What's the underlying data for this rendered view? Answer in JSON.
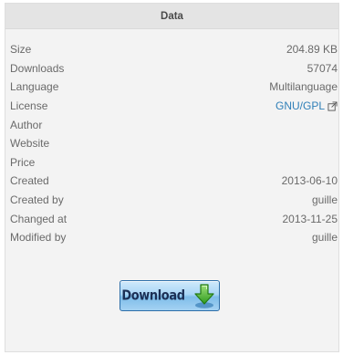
{
  "panel": {
    "title": "Data"
  },
  "rows": [
    {
      "label": "Size",
      "value": "204.89 KB"
    },
    {
      "label": "Downloads",
      "value": "57074"
    },
    {
      "label": "Language",
      "value": "Multilanguage"
    },
    {
      "label": "License",
      "value": "GNU/GPL"
    },
    {
      "label": "Author",
      "value": ""
    },
    {
      "label": "Website",
      "value": ""
    },
    {
      "label": "Price",
      "value": ""
    },
    {
      "label": "Created",
      "value": "2013-06-10"
    },
    {
      "label": "Created by",
      "value": "guille"
    },
    {
      "label": "Changed at",
      "value": "2013-11-25"
    },
    {
      "label": "Modified by",
      "value": "guille"
    }
  ],
  "download": {
    "label": "Download",
    "icon": "download-arrow-icon"
  },
  "colors": {
    "link": "#2f7fb8",
    "button_border": "#2d6ea8",
    "arrow_green": "#3fae2a"
  }
}
